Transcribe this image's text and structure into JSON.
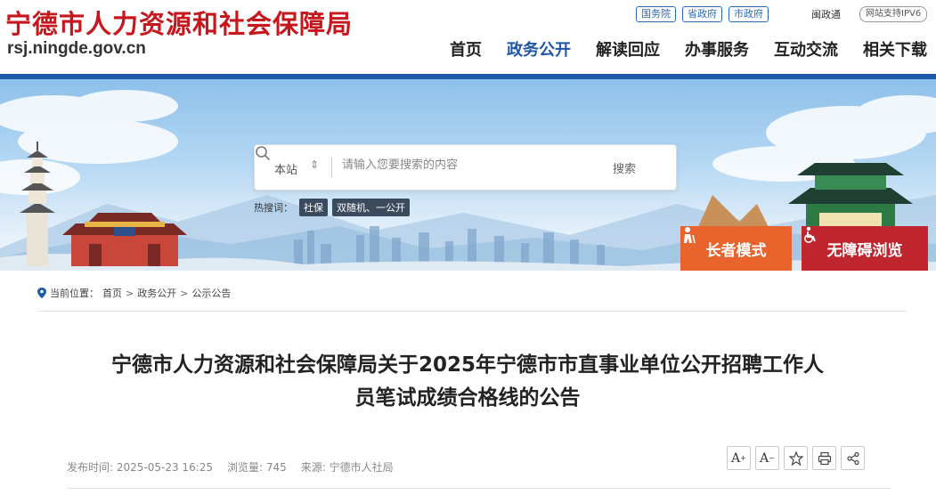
{
  "header": {
    "site_title": "宁德市人力资源和社会保障局",
    "domain": "rsj.ningde.gov.cn",
    "top_links": [
      "国务院",
      "省政府",
      "市政府"
    ],
    "min_gov": "闽政通",
    "ipv6": "网站支持IPV6",
    "nav": [
      "首页",
      "政务公开",
      "解读回应",
      "办事服务",
      "互动交流",
      "相关下载"
    ],
    "active_nav": "政务公开"
  },
  "search": {
    "scope": "本站",
    "placeholder": "请输入您要搜索的内容",
    "button": "搜索",
    "hot_label": "热搜词：",
    "hot_words": [
      "社保",
      "双随机、一公开"
    ]
  },
  "modes": {
    "elder": "长者模式",
    "accessible": "无障碍浏览"
  },
  "breadcrumb": {
    "label": "当前位置：",
    "items": [
      "首页",
      "政务公开",
      "公示公告"
    ],
    "separator": ">"
  },
  "article": {
    "title_line1": "宁德市人力资源和社会保障局关于2025年宁德市市直事业单位公开招聘工作人",
    "title_line2": "员笔试成绩合格线的公告",
    "publish_label": "发布时间:",
    "publish_time": "2025-05-23 16:25",
    "views_label": "浏览量:",
    "views": "745",
    "source_label": "来源:",
    "source": "宁德市人社局"
  },
  "tools": [
    "font-increase-icon",
    "font-decrease-icon",
    "favorite-icon",
    "print-icon",
    "share-icon"
  ],
  "colors": {
    "brand_red": "#c8161d",
    "nav_blue": "#1d5aaa",
    "elder_orange": "#e8642c",
    "access_red": "#c0262d"
  }
}
